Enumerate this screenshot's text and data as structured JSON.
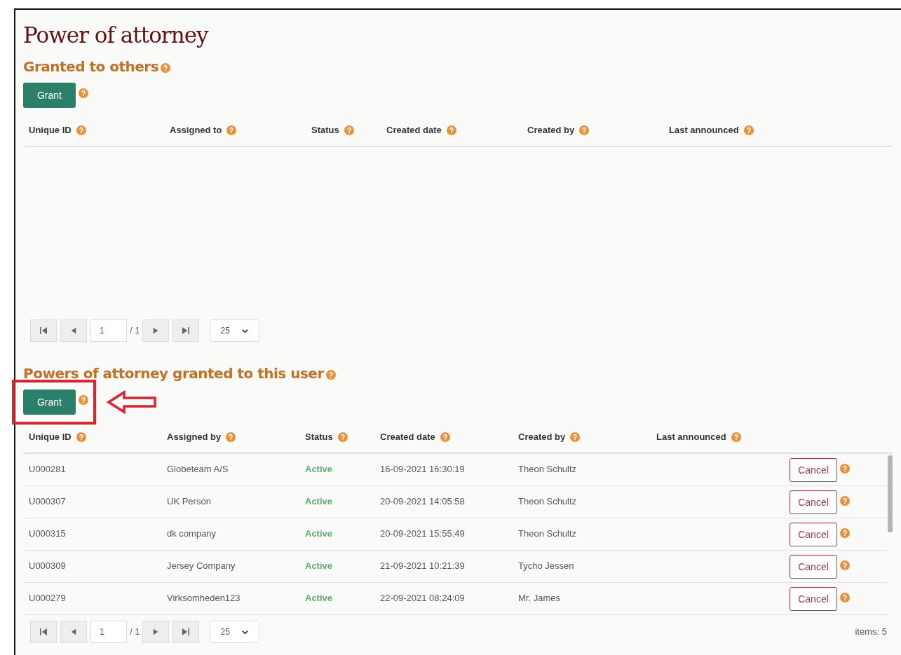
{
  "title": "Power of attorney",
  "sections": [
    {
      "heading": "Granted to others",
      "grant_button": "Grant",
      "columns": [
        "Unique ID",
        "Assigned to",
        "Status",
        "Created date",
        "Created by",
        "Last announced"
      ],
      "pager": {
        "page": "1",
        "of": "/ 1",
        "page_size": "25"
      },
      "highlighted": false
    },
    {
      "heading": "Powers of attorney granted to this user",
      "grant_button": "Grant",
      "columns": [
        "Unique ID",
        "Assigned by",
        "Status",
        "Created date",
        "Created by",
        "Last announced"
      ],
      "rows": [
        {
          "id": "U000281",
          "party": "Globeteam A/S",
          "status": "Active",
          "created_date": "16-09-2021 16:30:19",
          "created_by": "Theon Schultz",
          "action": "Cancel"
        },
        {
          "id": "U000307",
          "party": "UK Person",
          "status": "Active",
          "created_date": "20-09-2021 14:05:58",
          "created_by": "Theon Schultz",
          "action": "Cancel"
        },
        {
          "id": "U000315",
          "party": "dk company",
          "status": "Active",
          "created_date": "20-09-2021 15:55:49",
          "created_by": "Theon Schultz",
          "action": "Cancel"
        },
        {
          "id": "U000309",
          "party": "Jersey Company",
          "status": "Active",
          "created_date": "21-09-2021 10:21:39",
          "created_by": "Tycho Jessen",
          "action": "Cancel"
        },
        {
          "id": "U000279",
          "party": "Virksomheden123",
          "status": "Active",
          "created_date": "22-09-2021 08:24:09",
          "created_by": "Mr. James",
          "action": "Cancel"
        }
      ],
      "pager": {
        "page": "1",
        "of": "/ 1",
        "page_size": "25",
        "items": "items: 5"
      },
      "highlighted": true
    }
  ]
}
